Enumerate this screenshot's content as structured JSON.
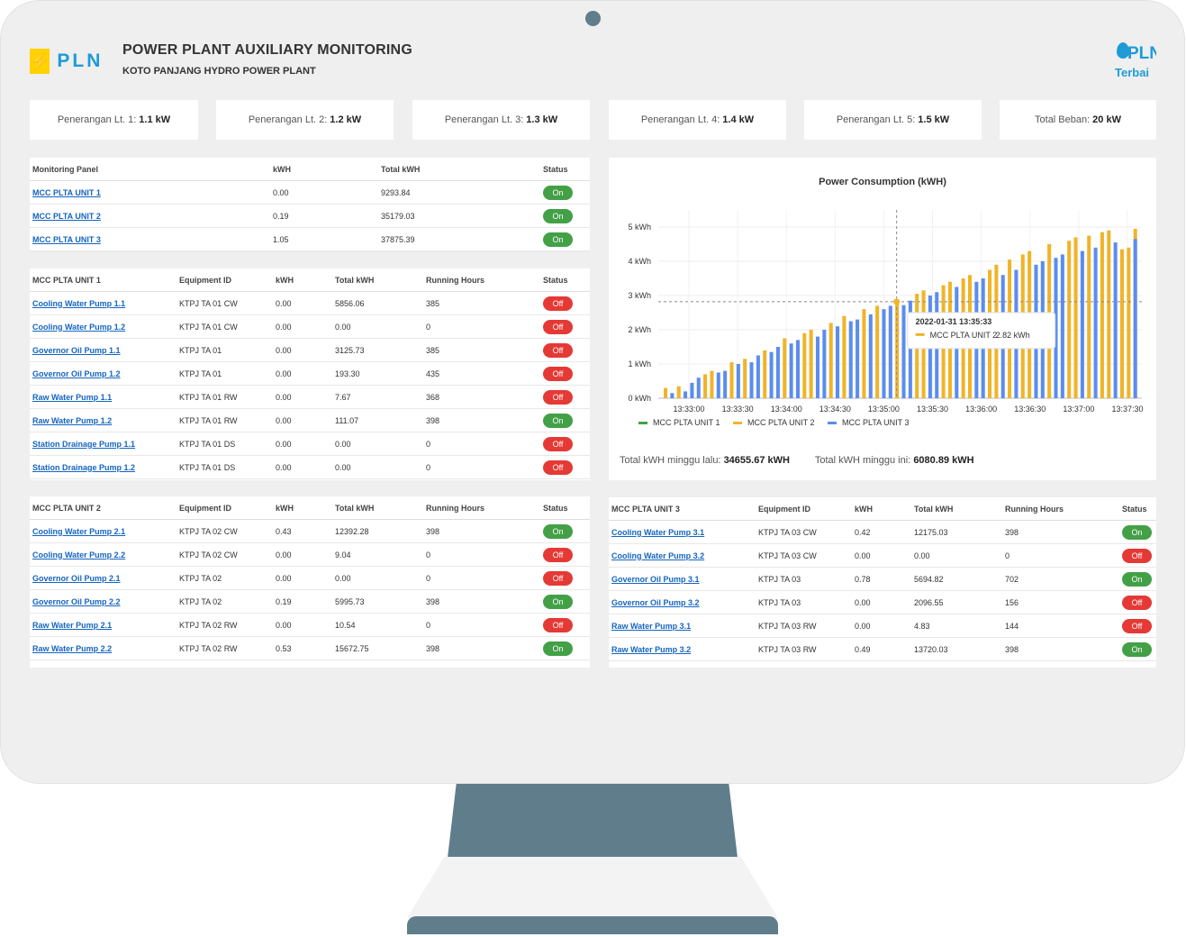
{
  "header": {
    "logo_text": "PLN",
    "title": "POWER PLANT AUXILIARY MONITORING",
    "subtitle": "KOTO PANJANG HYDRO POWER PLANT",
    "right_logo_line1": "PLN",
    "right_logo_line2": "Terbai"
  },
  "cards": [
    {
      "label": "Penerangan Lt. 1:",
      "value": "1.1 kW"
    },
    {
      "label": "Penerangan Lt. 2:",
      "value": "1.2 kW"
    },
    {
      "label": "Penerangan Lt. 3:",
      "value": "1.3 kW"
    },
    {
      "label": "Penerangan Lt. 4:",
      "value": "1.4 kW"
    },
    {
      "label": "Penerangan Lt. 5:",
      "value": "1.5 kW"
    },
    {
      "label": "Total Beban:",
      "value": "20 kW"
    }
  ],
  "monitoring": {
    "headers": [
      "Monitoring Panel",
      "kWH",
      "Total kWH",
      "Status"
    ],
    "rows": [
      [
        "MCC PLTA UNIT 1",
        "0.00",
        "9293.84",
        "On"
      ],
      [
        "MCC PLTA UNIT 2",
        "0.19",
        "35179.03",
        "On"
      ],
      [
        "MCC PLTA UNIT 3",
        "1.05",
        "37875.39",
        "On"
      ]
    ]
  },
  "unit1": {
    "headers": [
      "MCC PLTA UNIT 1",
      "Equipment ID",
      "kWH",
      "Total kWH",
      "Running Hours",
      "Status"
    ],
    "rows": [
      [
        "Cooling Water Pump 1.1",
        "KTPJ TA 01 CW",
        "0.00",
        "5856.06",
        "385",
        "Off"
      ],
      [
        "Cooling Water Pump 1.2",
        "KTPJ TA 01 CW",
        "0.00",
        "0.00",
        "0",
        "Off"
      ],
      [
        "Governor Oil Pump 1.1",
        "KTPJ TA 01",
        "0.00",
        "3125.73",
        "385",
        "Off"
      ],
      [
        "Governor Oil Pump 1.2",
        "KTPJ TA 01",
        "0.00",
        "193.30",
        "435",
        "Off"
      ],
      [
        "Raw Water Pump 1.1",
        "KTPJ TA 01 RW",
        "0.00",
        "7.67",
        "368",
        "Off"
      ],
      [
        "Raw Water Pump 1.2",
        "KTPJ TA 01 RW",
        "0.00",
        "111.07",
        "398",
        "On"
      ],
      [
        "Station Drainage Pump 1.1",
        "KTPJ TA 01 DS",
        "0.00",
        "0.00",
        "0",
        "Off"
      ],
      [
        "Station Drainage Pump 1.2",
        "KTPJ TA 01 DS",
        "0.00",
        "0.00",
        "0",
        "Off"
      ]
    ]
  },
  "unit2": {
    "headers": [
      "MCC PLTA UNIT 2",
      "Equipment ID",
      "kWH",
      "Total kWH",
      "Running Hours",
      "Status"
    ],
    "rows": [
      [
        "Cooling Water Pump 2.1",
        "KTPJ TA 02 CW",
        "0.43",
        "12392.28",
        "398",
        "On"
      ],
      [
        "Cooling Water Pump 2.2",
        "KTPJ TA 02 CW",
        "0.00",
        "9.04",
        "0",
        "Off"
      ],
      [
        "Governor Oil Pump 2.1",
        "KTPJ TA 02",
        "0.00",
        "0.00",
        "0",
        "Off"
      ],
      [
        "Governor Oil Pump 2.2",
        "KTPJ TA 02",
        "0.19",
        "5995.73",
        "398",
        "On"
      ],
      [
        "Raw Water Pump 2.1",
        "KTPJ TA 02 RW",
        "0.00",
        "10.54",
        "0",
        "Off"
      ],
      [
        "Raw Water Pump 2.2",
        "KTPJ TA 02 RW",
        "0.53",
        "15672.75",
        "398",
        "On"
      ]
    ]
  },
  "unit3": {
    "headers": [
      "MCC PLTA UNIT 3",
      "Equipment ID",
      "kWH",
      "Total kWH",
      "Running Hours",
      "Status"
    ],
    "rows": [
      [
        "Cooling Water Pump 3.1",
        "KTPJ TA 03 CW",
        "0.42",
        "12175.03",
        "398",
        "On"
      ],
      [
        "Cooling Water Pump 3.2",
        "KTPJ TA 03 CW",
        "0.00",
        "0.00",
        "0",
        "Off"
      ],
      [
        "Governor Oil Pump 3.1",
        "KTPJ TA 03",
        "0.78",
        "5694.82",
        "702",
        "On"
      ],
      [
        "Governor Oil Pump 3.2",
        "KTPJ TA 03",
        "0.00",
        "2096.55",
        "156",
        "Off"
      ],
      [
        "Raw Water Pump 3.1",
        "KTPJ TA 03 RW",
        "0.00",
        "4.83",
        "144",
        "Off"
      ],
      [
        "Raw Water Pump 3.2",
        "KTPJ TA 03 RW",
        "0.49",
        "13720.03",
        "398",
        "On"
      ]
    ]
  },
  "chart_footer": {
    "last_week_label": "Total kWH minggu lalu:",
    "last_week_value": "34655.67 kWH",
    "this_week_label": "Total kWH minggu ini:",
    "this_week_value": "6080.89 kWH"
  },
  "colors": {
    "unit1": "#43a047",
    "unit2": "#f0b429",
    "unit3": "#5b8def",
    "on": "#43a047",
    "off": "#e53935",
    "link": "#1565c0",
    "stand": "#607d8b"
  },
  "chart_data": {
    "type": "bar",
    "title": "Power Consumption (kWH)",
    "ylim": [
      0,
      5.5
    ],
    "yticks": [
      "0 kWh",
      "1 kWh",
      "2 kWh",
      "3 kWh",
      "4 kWh",
      "5 kWh"
    ],
    "xticks": [
      "13:33:00",
      "13:33:30",
      "13:34:00",
      "13:34:30",
      "13:35:00",
      "13:35:30",
      "13:36:00",
      "13:36:30",
      "13:37:00",
      "13:37:30"
    ],
    "grid": true,
    "legend_position": "bottom-left",
    "series": [
      {
        "name": "MCC PLTA UNIT 1",
        "color": "#43a047",
        "values": [
          0,
          0,
          0,
          0,
          0,
          0,
          0,
          0,
          0,
          0,
          0,
          0,
          0,
          0,
          0,
          0,
          0,
          0,
          0,
          0,
          0,
          0,
          0,
          0,
          0,
          0,
          0,
          0,
          0,
          0,
          0,
          0,
          0,
          0,
          0,
          0,
          0,
          0,
          0,
          0,
          0,
          0,
          0,
          0,
          0,
          0,
          0,
          0,
          0,
          0,
          0,
          0,
          0,
          0,
          0,
          0,
          0,
          0,
          0,
          0,
          0,
          0,
          0,
          0,
          0,
          0,
          0,
          0,
          0,
          0,
          0,
          0
        ]
      },
      {
        "name": "MCC PLTA UNIT 2",
        "color": "#f0b429",
        "values": [
          0.3,
          0,
          0.35,
          0,
          0,
          0,
          0.7,
          0.8,
          0,
          0,
          1.05,
          0,
          1.15,
          0,
          0,
          1.4,
          0,
          0,
          1.75,
          0,
          0,
          1.9,
          2.0,
          0,
          0,
          2.2,
          0,
          2.4,
          0,
          0,
          2.6,
          0,
          2.7,
          0,
          0,
          2.82,
          0,
          0,
          3.05,
          3.15,
          0,
          0,
          3.3,
          3.4,
          0,
          3.5,
          3.6,
          0,
          0,
          3.75,
          3.9,
          0,
          4.05,
          0,
          4.2,
          4.3,
          0,
          0,
          4.5,
          0,
          0,
          4.6,
          4.7,
          0,
          4.75,
          0,
          4.85,
          4.9,
          0,
          4.35,
          4.4,
          4.95
        ]
      },
      {
        "name": "MCC PLTA UNIT 3",
        "color": "#5b8def",
        "values": [
          0,
          0.15,
          0,
          0.2,
          0.45,
          0.6,
          0,
          0,
          0.75,
          0.8,
          0,
          1.0,
          0,
          1.05,
          1.25,
          0,
          1.35,
          1.5,
          0,
          1.6,
          1.7,
          0,
          0,
          1.8,
          2.0,
          0,
          2.1,
          0,
          2.25,
          2.3,
          0,
          2.45,
          0,
          2.6,
          2.7,
          0,
          2.72,
          2.85,
          0,
          0,
          3.0,
          3.1,
          0,
          0,
          3.25,
          0,
          0,
          3.4,
          3.5,
          0,
          0,
          3.6,
          0,
          3.75,
          0,
          0,
          3.9,
          4.0,
          0,
          4.1,
          4.2,
          0,
          0,
          4.3,
          0,
          4.4,
          0,
          0,
          4.55,
          0,
          0,
          4.65
        ]
      }
    ],
    "tooltip": {
      "time": "2022-01-31 13:35:33",
      "series": "MCC PLTA UNIT 2",
      "value": "2.82 kWh"
    }
  }
}
